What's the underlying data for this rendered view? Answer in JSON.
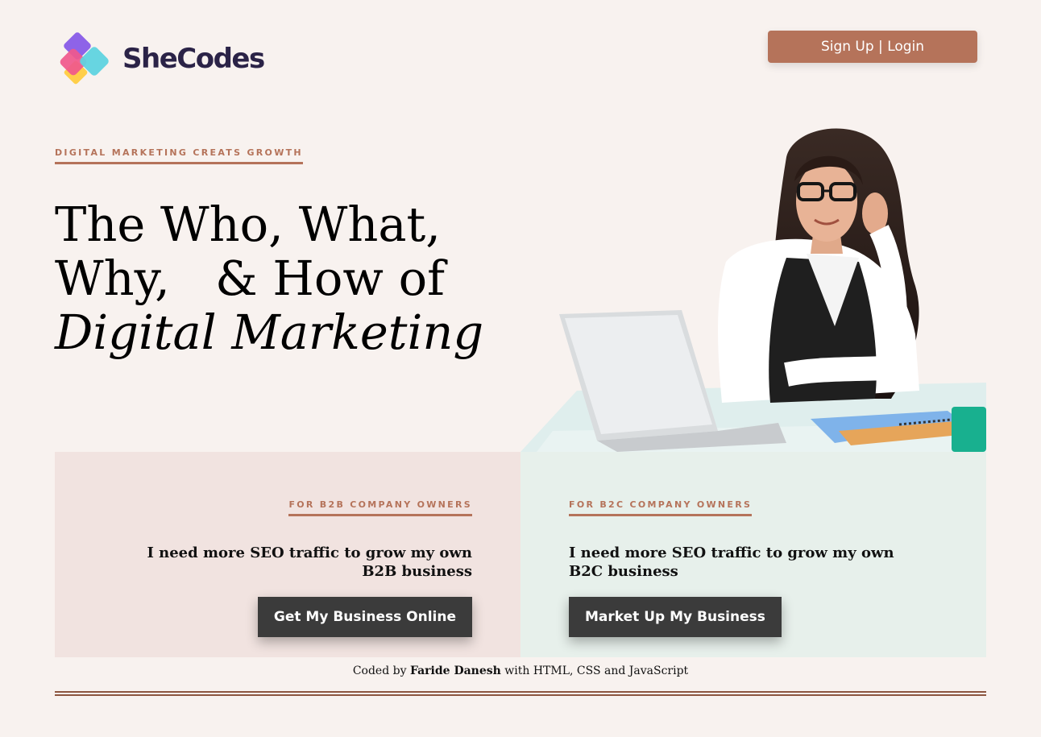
{
  "header": {
    "brand": "SheCodes",
    "signup_label": "Sign Up | Login"
  },
  "hero": {
    "eyebrow": "DIGITAL MARKETING CREATS GROWTH",
    "headline_line1": "The Who, What,",
    "headline_line2": "Why,   & How of",
    "headline_line3": "Digital Marketing"
  },
  "b2b": {
    "eyebrow": "FOR B2B COMPANY OWNERS",
    "question": "I need more SEO traffic to grow my own B2B business",
    "button": "Get My Business Online"
  },
  "b2c": {
    "eyebrow": "FOR B2C COMPANY OWNERS",
    "question": "I need more SEO traffic to grow my own B2C business",
    "button": "Market Up My Business"
  },
  "footer": {
    "prefix": "Coded by ",
    "author": "Faride Danesh",
    "suffix": " with HTML, CSS and JavaScript"
  },
  "colors": {
    "accent": "#b5735a",
    "background": "#f8f2ef",
    "b2b_panel": "#f1e3e0",
    "b2c_panel": "#e7f0eb",
    "button_dark": "#3b3b3b"
  },
  "icons": {
    "logo": "shecodes-logo-icon",
    "photo": "woman-with-laptop-photo"
  }
}
